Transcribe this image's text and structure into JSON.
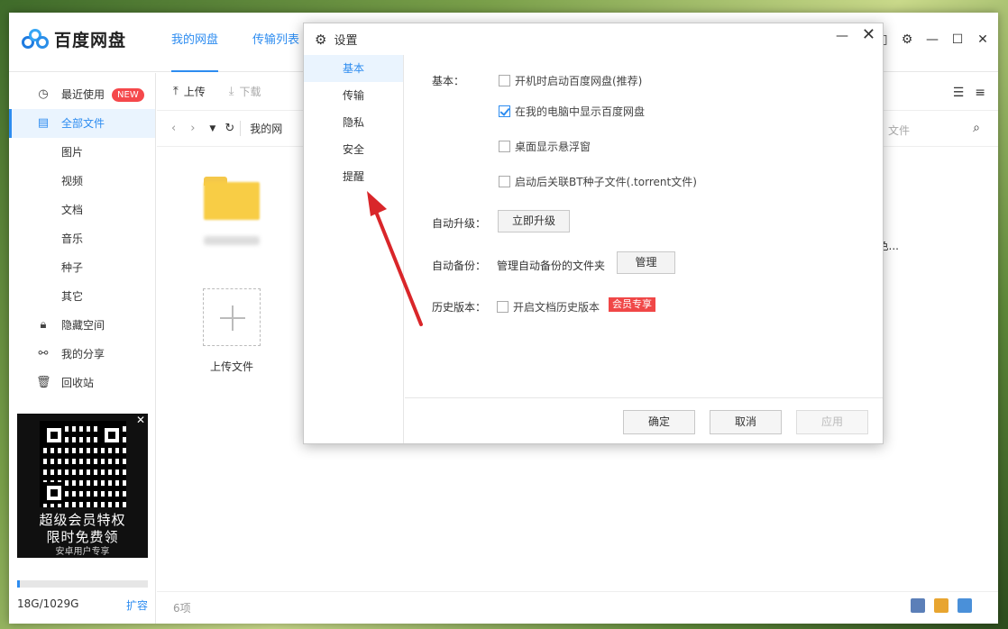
{
  "app": {
    "name": "百度网盘",
    "nav_tabs": [
      "我的网盘",
      "传输列表"
    ]
  },
  "sidebar": {
    "items": [
      {
        "label": "最近使用",
        "badge": "NEW",
        "icon": "clock-icon"
      },
      {
        "label": "全部文件",
        "icon": "file-icon"
      },
      {
        "label": "图片"
      },
      {
        "label": "视频"
      },
      {
        "label": "文档"
      },
      {
        "label": "音乐"
      },
      {
        "label": "种子"
      },
      {
        "label": "其它"
      },
      {
        "label": "隐藏空间",
        "icon": "lock-icon"
      },
      {
        "label": "我的分享",
        "icon": "share-icon"
      },
      {
        "label": "回收站",
        "icon": "trash-icon"
      }
    ],
    "promo": {
      "line1": "超级会员特权",
      "line2": "限时免费领",
      "line3": "安卓用户专享"
    },
    "storage": {
      "used_text": "18G/1029G",
      "expand": "扩容",
      "used_fraction": 0.0175
    }
  },
  "toolbar": {
    "upload": "上传",
    "download": "下载"
  },
  "pathbar": {
    "path": "我的网",
    "search_hint": "文件"
  },
  "files": {
    "upload_label": "上传文件",
    "right_text": "色..."
  },
  "status": {
    "count": "6项"
  },
  "dialog": {
    "title": "设置",
    "tabs": [
      "基本",
      "传输",
      "隐私",
      "安全",
      "提醒"
    ],
    "basic_label": "基本：",
    "options": [
      {
        "label": "开机时启动百度网盘(推荐)",
        "checked": false
      },
      {
        "label": "在我的电脑中显示百度网盘",
        "checked": true
      },
      {
        "label": "桌面显示悬浮窗",
        "checked": false
      },
      {
        "label": "启动后关联BT种子文件(.torrent文件)",
        "checked": false
      }
    ],
    "auto_upgrade_label": "自动升级：",
    "upgrade_button": "立即升级",
    "auto_backup_label": "自动备份：",
    "backup_desc": "管理自动备份的文件夹",
    "manage_button": "管理",
    "history_label": "历史版本：",
    "history_option": "开启文档历史版本",
    "vip_tag": "会员专享",
    "ok": "确定",
    "cancel": "取消",
    "apply": "应用"
  },
  "colors": {
    "accent": "#2d8cf0",
    "badge_red": "#f5484b",
    "arrow_red": "#d9262a"
  }
}
